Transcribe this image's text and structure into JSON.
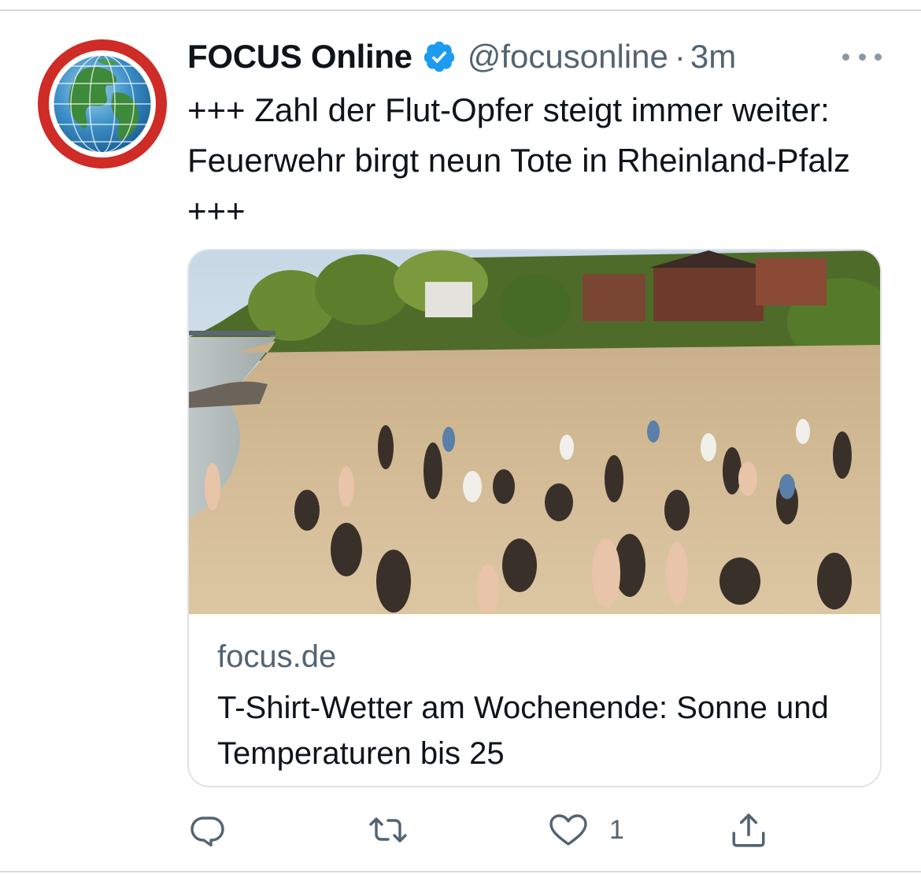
{
  "tweet": {
    "display_name": "FOCUS Online",
    "handle": "@focusonline",
    "separator": "·",
    "time": "3m",
    "text": "+++ Zahl der Flut-Opfer steigt immer weiter: Feuerwehr birgt neun Tote in Rheinland-Pfalz +++",
    "verified": true,
    "avatar_icon": "globe-icon",
    "avatar_ring_color": "#cf2b27",
    "verified_color": "#1d9bf0"
  },
  "card": {
    "domain": "focus.de",
    "title": "T-Shirt-Wetter am Wochenende: Sonne und Temperaturen bis 25",
    "image_description_icon": "beach-photo"
  },
  "actions": {
    "reply_icon": "reply-icon",
    "retweet_icon": "retweet-icon",
    "like_icon": "heart-icon",
    "like_count": "1",
    "share_icon": "share-icon"
  },
  "colors": {
    "text_primary": "#0f1419",
    "text_secondary": "#536471",
    "border": "#dfe3e7"
  }
}
